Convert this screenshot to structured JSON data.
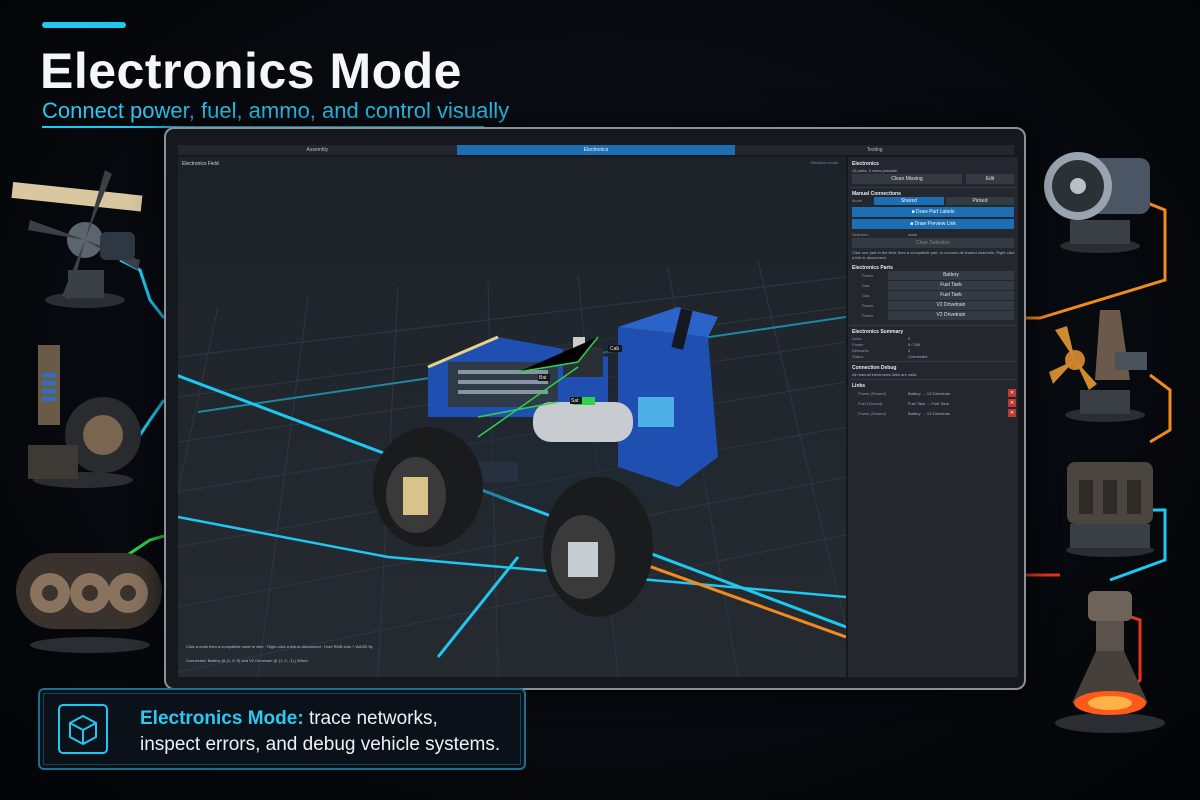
{
  "hero": {
    "title": "Electronics Mode",
    "subtitle": "Connect power, fuel, ammo, and control visually"
  },
  "app": {
    "tabs": [
      {
        "label": "Assembly",
        "active": false
      },
      {
        "label": "Electronics",
        "active": true
      },
      {
        "label": "Testing",
        "active": false
      }
    ],
    "viewport": {
      "label": "Electronics Field",
      "hint": "Selection mode",
      "help": "Click a node then a compatible node to wire · Right-click a link to disconnect · Hold RMB look + WASD fly",
      "status": "Connected: Battery @ (1, 0, 0) and V2 Drivetrain @ (1, 0, -1) | Wired",
      "tags": [
        "Cab",
        "Sat",
        "Bat"
      ]
    },
    "panel": {
      "electronics_title": "Electronics",
      "electronics_desc": "15 parts, 3 wires possible",
      "clean_missing": "Clean Missing",
      "edit": "Edit",
      "manual_title": "Manual Connections",
      "mode_label": "Mode",
      "mode_options": [
        "Shared",
        "Picked"
      ],
      "draw_part_labels": "■ Draw Part Labels",
      "draw_preview_link": "■ Draw Preview Link",
      "selected_label": "Selected",
      "selected_value": "none",
      "clear_selection": "Clear Selection",
      "instructions": "Click one part in the field, then a compatible part, to connect all shared channels. Right-click a link to disconnect.",
      "parts_title": "Electronics Parts",
      "parts": [
        {
          "channel": "Power",
          "name": "Battery"
        },
        {
          "channel": "Gas",
          "name": "Fuel Tank"
        },
        {
          "channel": "Gas",
          "name": "Fuel Tank"
        },
        {
          "channel": "Power",
          "name": "V2 Drivetrain"
        },
        {
          "channel": "Power",
          "name": "V2 Drivetrain"
        }
      ],
      "summary_title": "Electronics Summary",
      "summary": [
        {
          "label": "Links",
          "value": "3"
        },
        {
          "label": "Power",
          "value": "0 / 200"
        },
        {
          "label": "Networks",
          "value": "2"
        },
        {
          "label": "Status",
          "value": "Connected"
        }
      ],
      "debug_title": "Connection Debug",
      "debug_text": "All manual electronics links are valid.",
      "links_title": "Links",
      "links": [
        {
          "channel": "Power (Shared)",
          "route": "Battery → V2 Drivetrain"
        },
        {
          "channel": "Fuel (Shared)",
          "route": "Fuel Tank → Fuel Tank"
        },
        {
          "channel": "Power (Shared)",
          "route": "Battery → V2 Drivetrain"
        }
      ],
      "remove_glyph": "✕"
    }
  },
  "callout": {
    "emphasis": "Electronics Mode:",
    "line1_rest": "trace networks,",
    "line2": "inspect errors, and debug vehicle systems."
  },
  "colors": {
    "accent": "#1ec8f0",
    "tab_active": "#1d6fb4",
    "wire_blue": "#1ec8f0",
    "wire_orange": "#f28a1e",
    "wire_green": "#2fd14a",
    "wire_red": "#e8331c",
    "vehicle_blue": "#1f4fb0"
  },
  "icons": [
    "propeller-engine-icon",
    "suspension-wheel-icon",
    "tank-track-icon",
    "jet-turbine-icon",
    "boat-propeller-icon",
    "engine-block-icon",
    "thruster-nozzle-icon",
    "cube-icon"
  ]
}
